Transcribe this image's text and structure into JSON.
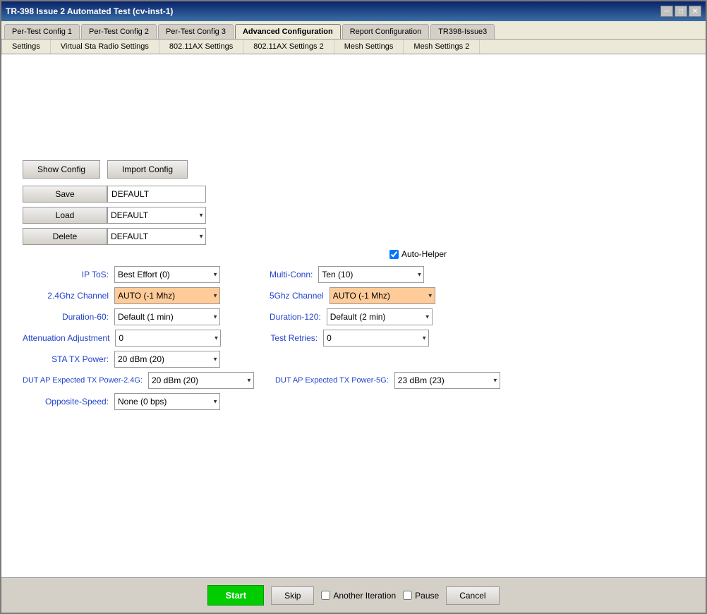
{
  "window": {
    "title": "TR-398 Issue 2 Automated Test  (cv-inst-1)"
  },
  "tabs1": [
    {
      "label": "Per-Test Config 1",
      "active": false
    },
    {
      "label": "Per-Test Config 2",
      "active": false
    },
    {
      "label": "Per-Test Config 3",
      "active": false
    },
    {
      "label": "Advanced Configuration",
      "active": true
    },
    {
      "label": "Report Configuration",
      "active": false
    },
    {
      "label": "TR398-Issue3",
      "active": false
    }
  ],
  "tabs2": [
    {
      "label": "Settings"
    },
    {
      "label": "Virtual Sta Radio Settings"
    },
    {
      "label": "802.11AX Settings"
    },
    {
      "label": "802.11AX Settings 2"
    },
    {
      "label": "Mesh Settings"
    },
    {
      "label": "Mesh Settings 2"
    }
  ],
  "buttons": {
    "show_config": "Show Config",
    "import_config": "Import Config"
  },
  "save": {
    "label": "Save",
    "value": "DEFAULT"
  },
  "load": {
    "label": "Load",
    "value": "DEFAULT"
  },
  "delete": {
    "label": "Delete",
    "value": "DEFAULT"
  },
  "auto_helper": {
    "label": "Auto-Helper",
    "checked": true
  },
  "fields": {
    "ip_tos": {
      "label": "IP ToS:",
      "value": "Best Effort  (0)"
    },
    "multi_conn": {
      "label": "Multi-Conn:",
      "value": "Ten (10)"
    },
    "ghz24_channel": {
      "label": "2.4Ghz Channel",
      "value": "AUTO (-1 Mhz)"
    },
    "ghz5_channel": {
      "label": "5Ghz Channel",
      "value": "AUTO (-1 Mhz)"
    },
    "duration_60": {
      "label": "Duration-60:",
      "value": "Default (1 min)"
    },
    "duration_120": {
      "label": "Duration-120:",
      "value": "Default (2 min)"
    },
    "attenuation_adj": {
      "label": "Attenuation Adjustment",
      "value": "0"
    },
    "test_retries": {
      "label": "Test Retries:",
      "value": "0"
    },
    "sta_tx_power": {
      "label": "STA TX Power:",
      "value": "20  dBm (20)"
    },
    "dut_ap_tx_power_24g": {
      "label": "DUT AP Expected TX Power-2.4G:",
      "value": "20  dBm (20)"
    },
    "dut_ap_tx_power_5g": {
      "label": "DUT AP Expected TX Power-5G:",
      "value": "23  dBm (23)"
    },
    "opposite_speed": {
      "label": "Opposite-Speed:",
      "value": "None (0 bps)"
    }
  },
  "bottom": {
    "start": "Start",
    "skip": "Skip",
    "another_iteration": "Another Iteration",
    "pause": "Pause",
    "cancel": "Cancel"
  },
  "title_btn": {
    "minimize": "─",
    "maximize": "□",
    "close": "✕"
  }
}
